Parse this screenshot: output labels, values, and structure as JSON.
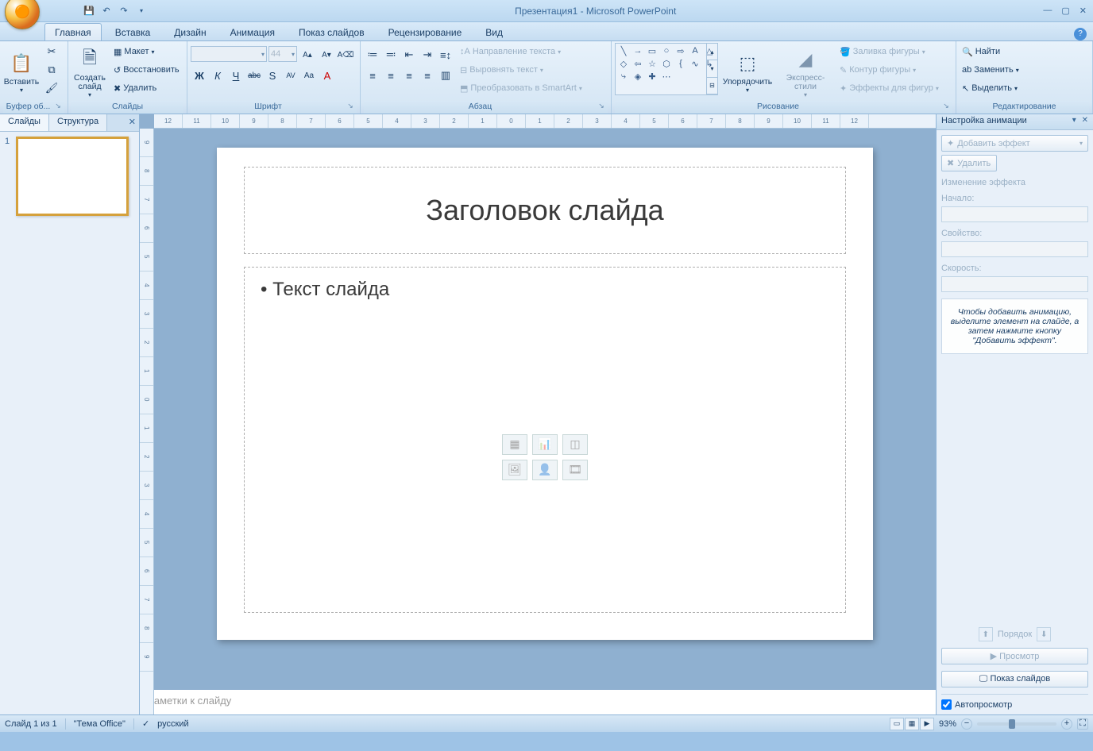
{
  "title": "Презентация1 - Microsoft PowerPoint",
  "tabs": [
    "Главная",
    "Вставка",
    "Дизайн",
    "Анимация",
    "Показ слайдов",
    "Рецензирование",
    "Вид"
  ],
  "activeTab": 0,
  "ribbon": {
    "clipboard": {
      "label": "Буфер об...",
      "paste": "Вставить"
    },
    "slides": {
      "label": "Слайды",
      "new": "Создать\nслайд",
      "layout": "Макет",
      "reset": "Восстановить",
      "delete": "Удалить"
    },
    "font": {
      "label": "Шрифт",
      "fontName": "",
      "size": "44",
      "bold": "Ж",
      "italic": "К",
      "underline": "Ч",
      "strike": "abc",
      "shadow": "S",
      "spacing": "AV",
      "case": "Aa",
      "color": "A"
    },
    "paragraph": {
      "label": "Абзац",
      "textdir": "Направление текста",
      "align": "Выровнять текст",
      "smartart": "Преобразовать в SmartArt"
    },
    "drawing": {
      "label": "Рисование",
      "arrange": "Упорядочить",
      "quickstyles": "Экспресс-стили",
      "fill": "Заливка фигуры",
      "outline": "Контур фигуры",
      "effects": "Эффекты для фигур"
    },
    "editing": {
      "label": "Редактирование",
      "find": "Найти",
      "replace": "Заменить",
      "select": "Выделить"
    }
  },
  "panes": {
    "slides": "Слайды",
    "outline": "Структура"
  },
  "slide": {
    "num": "1",
    "title": "Заголовок слайда",
    "body": "Текст слайда"
  },
  "notes": "Заметки к слайду",
  "anim": {
    "title": "Настройка анимации",
    "addEffect": "Добавить эффект",
    "remove": "Удалить",
    "changeEffect": "Изменение эффекта",
    "start": "Начало:",
    "property": "Свойство:",
    "speed": "Скорость:",
    "hint": "Чтобы добавить анимацию, выделите элемент на слайде, а затем нажмите кнопку \"Добавить эффект\".",
    "reorder": "Порядок",
    "play": "Просмотр",
    "slideshow": "Показ слайдов",
    "autopreview": "Автопросмотр"
  },
  "status": {
    "slide": "Слайд 1 из 1",
    "theme": "\"Тема Office\"",
    "lang": "русский",
    "zoom": "93%"
  }
}
